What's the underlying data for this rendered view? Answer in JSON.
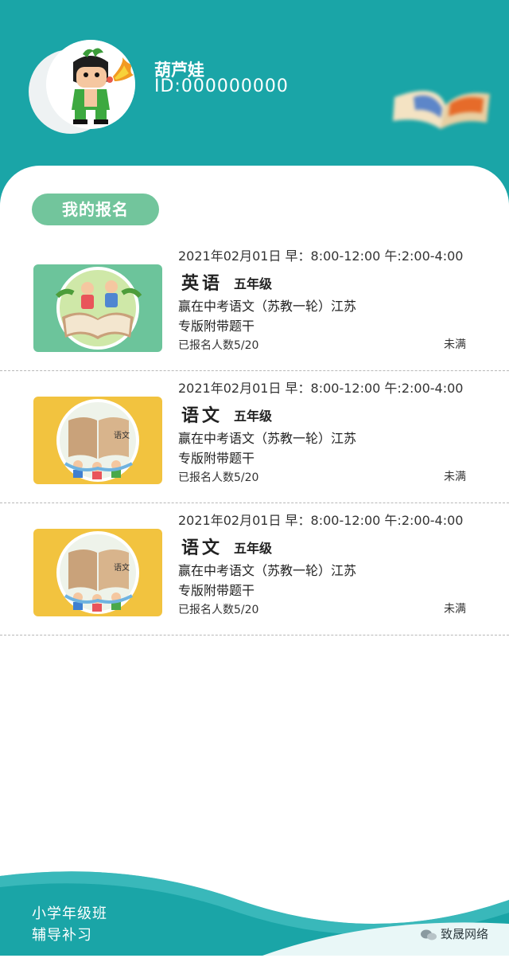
{
  "user": {
    "name": "葫芦娃",
    "id": "ID:000000000"
  },
  "section": {
    "title": "我的报名"
  },
  "courses": [
    {
      "time": "2021年02月01日 早：8:00-12:00 午:2:00-4:00",
      "subject": "英语",
      "grade": "五年级",
      "desc_line1": "赢在中考语文（苏教一轮）江苏",
      "desc_line2": "专版附带题干",
      "enrolled": "已报名人数5/20",
      "status": "未满",
      "thumb_bg": "#6cc49b",
      "thumb_icon": "english-kids-book-icon"
    },
    {
      "time": "2021年02月01日 早：8:00-12:00 午:2:00-4:00",
      "subject": "语文",
      "grade": "五年级",
      "desc_line1": "赢在中考语文（苏教一轮）江苏",
      "desc_line2": "专版附带题干",
      "enrolled": "已报名人数5/20",
      "status": "未满",
      "thumb_bg": "#f2c33f",
      "thumb_icon": "chinese-kids-book-icon"
    },
    {
      "time": "2021年02月01日 早：8:00-12:00 午:2:00-4:00",
      "subject": "语文",
      "grade": "五年级",
      "desc_line1": "赢在中考语文（苏教一轮）江苏",
      "desc_line2": "专版附带题干",
      "enrolled": "已报名人数5/20",
      "status": "未满",
      "thumb_bg": "#f2c33f",
      "thumb_icon": "chinese-kids-book-icon"
    }
  ],
  "footer": {
    "line1": "小学年级班",
    "line2": "辅导补习",
    "watermark": "致晟网络"
  },
  "colors": {
    "header": "#1aa5a7",
    "pill": "#72c59c",
    "english_thumb": "#6cc49b",
    "chinese_thumb": "#f2c33f"
  }
}
